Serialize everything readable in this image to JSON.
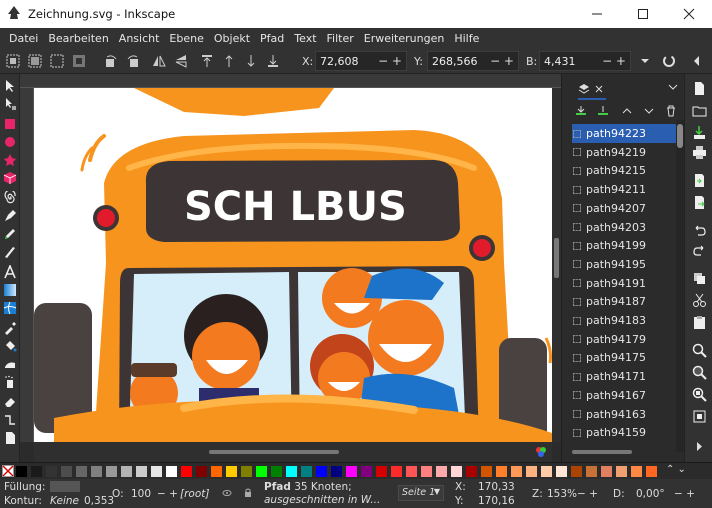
{
  "window": {
    "title": "Zeichnung.svg - Inkscape",
    "minimize_icon": "minimize-icon",
    "maximize_icon": "maximize-icon",
    "close_icon": "close-icon"
  },
  "menu": [
    "Datei",
    "Bearbeiten",
    "Ansicht",
    "Ebene",
    "Objekt",
    "Pfad",
    "Text",
    "Filter",
    "Erweiterungen",
    "Hilfe"
  ],
  "coords": {
    "x_label": "X:",
    "x_value": "72,608",
    "y_label": "Y:",
    "y_value": "268,566",
    "w_label": "B:",
    "w_value": "4,431",
    "plus_minus": "− +"
  },
  "canvas_text": {
    "bus_sign": "SCH  LBUS"
  },
  "objects": {
    "items": [
      "path94223",
      "path94219",
      "path94215",
      "path94211",
      "path94207",
      "path94203",
      "path94199",
      "path94195",
      "path94191",
      "path94187",
      "path94183",
      "path94179",
      "path94175",
      "path94171",
      "path94167",
      "path94163",
      "path94159"
    ],
    "selected_index": 0
  },
  "status": {
    "fill_label": "Füllung:",
    "stroke_label": "Kontur:",
    "stroke_value": "Keine",
    "stroke_width": "0,353",
    "opacity_label": "O:",
    "opacity_value": "100",
    "layer": "[root]",
    "message_bold": "Pfad",
    "message_rest": " 35 Knoten;",
    "message_line2": "ausgeschnitten in W...",
    "page": "Seite 1",
    "x_label": "X:",
    "x_value": "170,33",
    "y_label": "Y:",
    "y_value": "170,16",
    "zoom_label": "Z:",
    "zoom_value": "153%",
    "rot_label": "D:",
    "rot_value": "0,00°"
  },
  "colors": {
    "accent_selection": "#2a5eb0",
    "bus_orange": "#f7941d",
    "ui_dark": "#323232"
  }
}
